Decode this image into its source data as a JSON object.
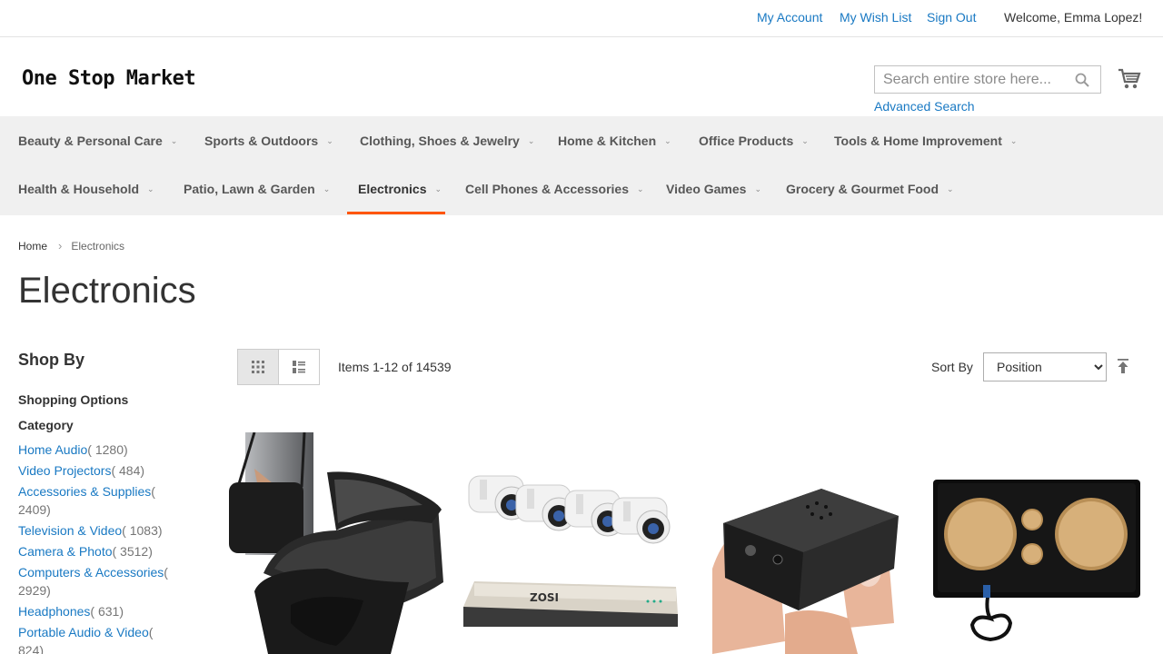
{
  "header": {
    "links": [
      "My Account",
      "My Wish List",
      "Sign Out"
    ],
    "welcome": "Welcome, Emma Lopez!",
    "logo": "One Stop Market",
    "search_placeholder": "Search entire store here...",
    "advanced_search": "Advanced Search"
  },
  "nav": {
    "row1": [
      "Beauty & Personal Care",
      "Sports & Outdoors",
      "Clothing, Shoes & Jewelry",
      "Home & Kitchen",
      "Office Products",
      "Tools & Home Improvement"
    ],
    "row2": [
      "Health & Household",
      "Patio, Lawn & Garden",
      "Electronics",
      "Cell Phones & Accessories",
      "Video Games",
      "Grocery & Gourmet Food"
    ],
    "active": "Electronics",
    "accent_color": "#ff5501"
  },
  "breadcrumb": {
    "home": "Home",
    "current": "Electronics"
  },
  "page_title": "Electronics",
  "sidebar": {
    "shop_by": "Shop By",
    "shopping_options": "Shopping Options",
    "category_title": "Category",
    "categories": [
      {
        "name": "Home Audio",
        "count": "( 1280)"
      },
      {
        "name": "Video Projectors",
        "count": "( 484)"
      },
      {
        "name": "Accessories & Supplies",
        "count": "( 2409)"
      },
      {
        "name": "Television & Video",
        "count": "( 1083)"
      },
      {
        "name": "Camera & Photo",
        "count": "( 3512)"
      },
      {
        "name": "Computers & Accessories",
        "count": "( 2929)"
      },
      {
        "name": "Headphones",
        "count": "( 631)"
      },
      {
        "name": "Portable Audio & Video",
        "count": "( 824)"
      }
    ]
  },
  "toolbar": {
    "items_count": "Items 1-12 of 14539",
    "sort_label": "Sort By",
    "sort_selected": "Position",
    "sort_options": [
      "Position"
    ]
  },
  "products": [
    {
      "icon": "carrying-case-image"
    },
    {
      "icon": "security-camera-set-image"
    },
    {
      "icon": "mini-camera-image"
    },
    {
      "icon": "speaker-box-image"
    }
  ],
  "colors": {
    "link": "#1979c3",
    "nav_bg": "#f0f0f0"
  }
}
